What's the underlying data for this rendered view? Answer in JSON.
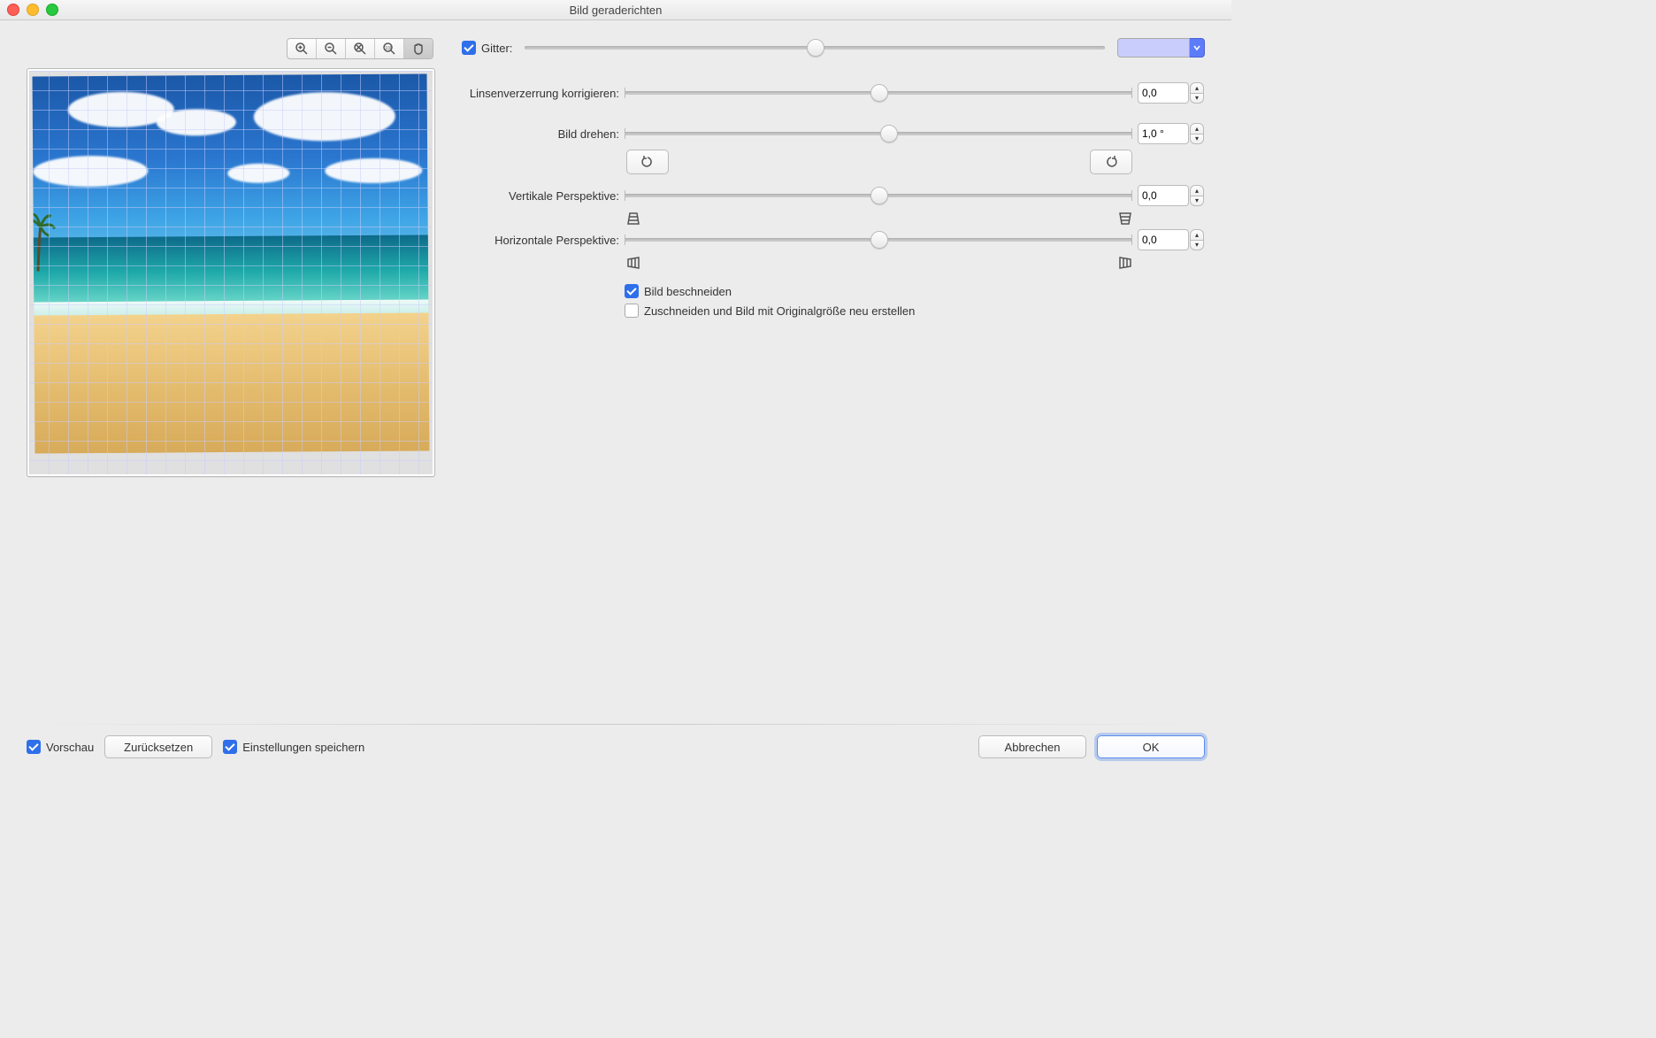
{
  "window": {
    "title": "Bild geraderichten"
  },
  "toolbar": {
    "grid_checkbox_label": "Gitter:",
    "grid_checked": true,
    "grid_slider_value": 50,
    "grid_color": "#c9cdfb"
  },
  "controls": {
    "lens": {
      "label": "Linsenverzerrung korrigieren:",
      "value": "0,0",
      "slider": 50
    },
    "rotate": {
      "label": "Bild drehen:",
      "value": "1,0 °",
      "slider": 52
    },
    "vpersp": {
      "label": "Vertikale Perspektive:",
      "value": "0,0",
      "slider": 50
    },
    "hpersp": {
      "label": "Horizontale Perspektive:",
      "value": "0,0",
      "slider": 50
    },
    "crop_label": "Bild beschneiden",
    "crop_checked": true,
    "resize_label": "Zuschneiden und Bild mit Originalgröße neu erstellen",
    "resize_checked": false
  },
  "footer": {
    "preview_label": "Vorschau",
    "preview_checked": true,
    "reset_label": "Zurücksetzen",
    "save_settings_label": "Einstellungen speichern",
    "save_settings_checked": true,
    "cancel_label": "Abbrechen",
    "ok_label": "OK"
  }
}
